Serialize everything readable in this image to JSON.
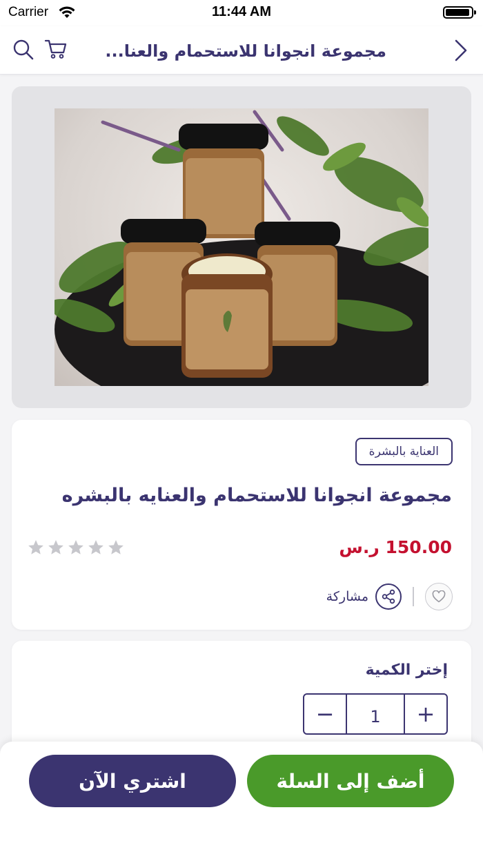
{
  "status_bar": {
    "carrier": "Carrier",
    "time": "11:44 AM"
  },
  "navbar": {
    "title": "مجموعة انجوانا للاستحمام والعنا...",
    "icons": [
      "back-chevron-icon",
      "search-icon",
      "cart-icon"
    ]
  },
  "product": {
    "image_icon": "product-photo-shea-butter-jars",
    "category": "العناية بالبشرة",
    "title": "مجموعة انجوانا للاستحمام والعنايه بالبشره",
    "price": "150.00 ر.س",
    "rating": 0,
    "rating_max": 5,
    "share_label": "مشاركة"
  },
  "quantity": {
    "label": "إختر الكمية",
    "value": "1",
    "minus": "−",
    "plus": "+"
  },
  "actions": {
    "buy_now": "اشتري الآن",
    "add_to_cart": "أضف إلى السلة"
  },
  "colors": {
    "primary": "#3b3470",
    "price": "#c4102f",
    "add_to_cart": "#4a9a2a",
    "star_empty": "#c7c7cc"
  }
}
